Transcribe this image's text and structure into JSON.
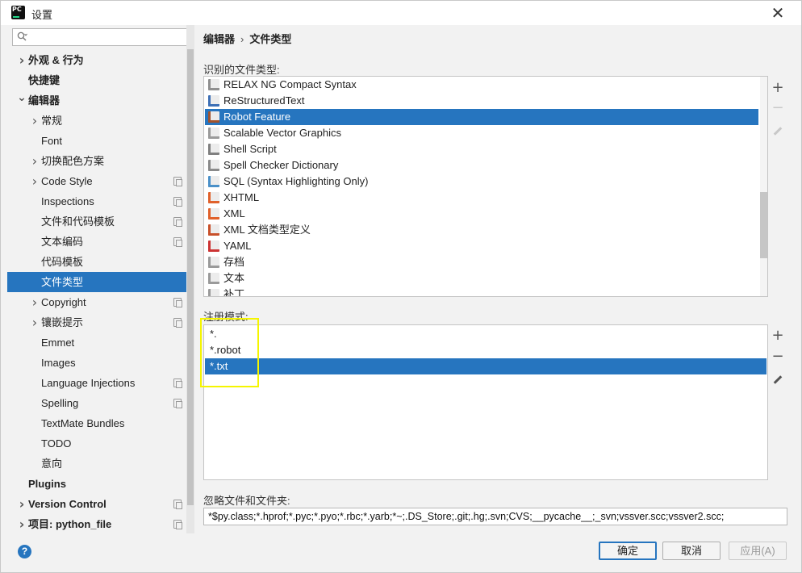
{
  "window": {
    "title": "设置"
  },
  "sidebar": {
    "search_placeholder": "",
    "items": [
      {
        "label": "外观 & 行为",
        "bold": true,
        "indent": 0,
        "chevron": "right",
        "copy": false,
        "selected": false,
        "name": "sidebar-item-appearance"
      },
      {
        "label": "快捷键",
        "bold": true,
        "indent": 0,
        "chevron": "",
        "copy": false,
        "selected": false,
        "name": "sidebar-item-keymap"
      },
      {
        "label": "编辑器",
        "bold": true,
        "indent": 0,
        "chevron": "down",
        "copy": false,
        "selected": false,
        "name": "sidebar-item-editor"
      },
      {
        "label": "常规",
        "bold": false,
        "indent": 1,
        "chevron": "right",
        "copy": false,
        "selected": false,
        "name": "sidebar-item-general"
      },
      {
        "label": "Font",
        "bold": false,
        "indent": 1,
        "chevron": "",
        "copy": false,
        "selected": false,
        "name": "sidebar-item-font"
      },
      {
        "label": "切换配色方案",
        "bold": false,
        "indent": 1,
        "chevron": "right",
        "copy": false,
        "selected": false,
        "name": "sidebar-item-color-scheme"
      },
      {
        "label": "Code Style",
        "bold": false,
        "indent": 1,
        "chevron": "right",
        "copy": true,
        "selected": false,
        "name": "sidebar-item-code-style"
      },
      {
        "label": "Inspections",
        "bold": false,
        "indent": 1,
        "chevron": "",
        "copy": true,
        "selected": false,
        "name": "sidebar-item-inspections"
      },
      {
        "label": "文件和代码模板",
        "bold": false,
        "indent": 1,
        "chevron": "",
        "copy": true,
        "selected": false,
        "name": "sidebar-item-file-templates"
      },
      {
        "label": "文本编码",
        "bold": false,
        "indent": 1,
        "chevron": "",
        "copy": true,
        "selected": false,
        "name": "sidebar-item-file-encodings"
      },
      {
        "label": "代码模板",
        "bold": false,
        "indent": 1,
        "chevron": "",
        "copy": false,
        "selected": false,
        "name": "sidebar-item-live-templates"
      },
      {
        "label": "文件类型",
        "bold": false,
        "indent": 1,
        "chevron": "",
        "copy": false,
        "selected": true,
        "name": "sidebar-item-file-types"
      },
      {
        "label": "Copyright",
        "bold": false,
        "indent": 1,
        "chevron": "right",
        "copy": true,
        "selected": false,
        "name": "sidebar-item-copyright"
      },
      {
        "label": "镶嵌提示",
        "bold": false,
        "indent": 1,
        "chevron": "right",
        "copy": true,
        "selected": false,
        "name": "sidebar-item-inlay-hints"
      },
      {
        "label": "Emmet",
        "bold": false,
        "indent": 1,
        "chevron": "",
        "copy": false,
        "selected": false,
        "name": "sidebar-item-emmet"
      },
      {
        "label": "Images",
        "bold": false,
        "indent": 1,
        "chevron": "",
        "copy": false,
        "selected": false,
        "name": "sidebar-item-images"
      },
      {
        "label": "Language Injections",
        "bold": false,
        "indent": 1,
        "chevron": "",
        "copy": true,
        "selected": false,
        "name": "sidebar-item-language-injections"
      },
      {
        "label": "Spelling",
        "bold": false,
        "indent": 1,
        "chevron": "",
        "copy": true,
        "selected": false,
        "name": "sidebar-item-spelling"
      },
      {
        "label": "TextMate Bundles",
        "bold": false,
        "indent": 1,
        "chevron": "",
        "copy": false,
        "selected": false,
        "name": "sidebar-item-textmate-bundles"
      },
      {
        "label": "TODO",
        "bold": false,
        "indent": 1,
        "chevron": "",
        "copy": false,
        "selected": false,
        "name": "sidebar-item-todo"
      },
      {
        "label": "意向",
        "bold": false,
        "indent": 1,
        "chevron": "",
        "copy": false,
        "selected": false,
        "name": "sidebar-item-intentions"
      },
      {
        "label": "Plugins",
        "bold": true,
        "indent": 0,
        "chevron": "",
        "copy": false,
        "selected": false,
        "name": "sidebar-item-plugins"
      },
      {
        "label": "Version Control",
        "bold": true,
        "indent": 0,
        "chevron": "right",
        "copy": true,
        "selected": false,
        "name": "sidebar-item-version-control"
      },
      {
        "label": "项目: python_file",
        "bold": true,
        "indent": 0,
        "chevron": "right",
        "copy": true,
        "selected": false,
        "name": "sidebar-item-project"
      }
    ]
  },
  "breadcrumb": {
    "parent": "编辑器",
    "separator": "›",
    "current": "文件类型"
  },
  "recognized": {
    "label": "识别的文件类型:",
    "items": [
      {
        "label": "RELAX NG Compact Syntax",
        "icon": "relaxng-file-icon",
        "color": "#8f8f8f",
        "selected": false
      },
      {
        "label": "ReStructuredText",
        "icon": "rst-file-icon",
        "color": "#3d6fb5",
        "selected": false
      },
      {
        "label": "Robot Feature",
        "icon": "robot-file-icon",
        "color": "#a0522d",
        "selected": true
      },
      {
        "label": "Scalable Vector Graphics",
        "icon": "svg-file-icon",
        "color": "#9a9a9a",
        "selected": false
      },
      {
        "label": "Shell Script",
        "icon": "shell-script-icon",
        "color": "#808080",
        "selected": false
      },
      {
        "label": "Spell Checker Dictionary",
        "icon": "dictionary-file-icon",
        "color": "#8a8a8a",
        "selected": false
      },
      {
        "label": "SQL (Syntax Highlighting Only)",
        "icon": "sql-file-icon",
        "color": "#4a90c8",
        "selected": false
      },
      {
        "label": "XHTML",
        "icon": "xhtml-file-icon",
        "color": "#e0612b",
        "selected": false
      },
      {
        "label": "XML",
        "icon": "xml-file-icon",
        "color": "#e0612b",
        "selected": false
      },
      {
        "label": "XML 文档类型定义",
        "icon": "dtd-file-icon",
        "color": "#c8502a",
        "selected": false
      },
      {
        "label": "YAML",
        "icon": "yaml-file-icon",
        "color": "#cc3333",
        "selected": false
      },
      {
        "label": "存档",
        "icon": "archive-file-icon",
        "color": "#9a9a9a",
        "selected": false
      },
      {
        "label": "文本",
        "icon": "text-file-icon",
        "color": "#9a9a9a",
        "selected": false
      },
      {
        "label": "补丁",
        "icon": "patch-file-icon",
        "color": "#9a9a9a",
        "selected": false
      }
    ],
    "scroll_fraction": 0.75
  },
  "patterns": {
    "label": "注册模式:",
    "items": [
      {
        "label": "*.",
        "selected": false
      },
      {
        "label": "*.robot",
        "selected": false
      },
      {
        "label": "*.txt",
        "selected": true
      }
    ]
  },
  "toolbar": {
    "add": "+",
    "remove": "−"
  },
  "ignore": {
    "label": "忽略文件和文件夹:",
    "value": "*$py.class;*.hprof;*.pyc;*.pyo;*.rbc;*.yarb;*~;.DS_Store;.git;.hg;.svn;CVS;__pycache__;_svn;vssver.scc;vssver2.scc;"
  },
  "buttons": {
    "help": "?",
    "ok": "确定",
    "cancel": "取消",
    "apply": "应用(A)"
  },
  "colors": {
    "accent": "#2675bf",
    "annotation": "#f5f500"
  }
}
